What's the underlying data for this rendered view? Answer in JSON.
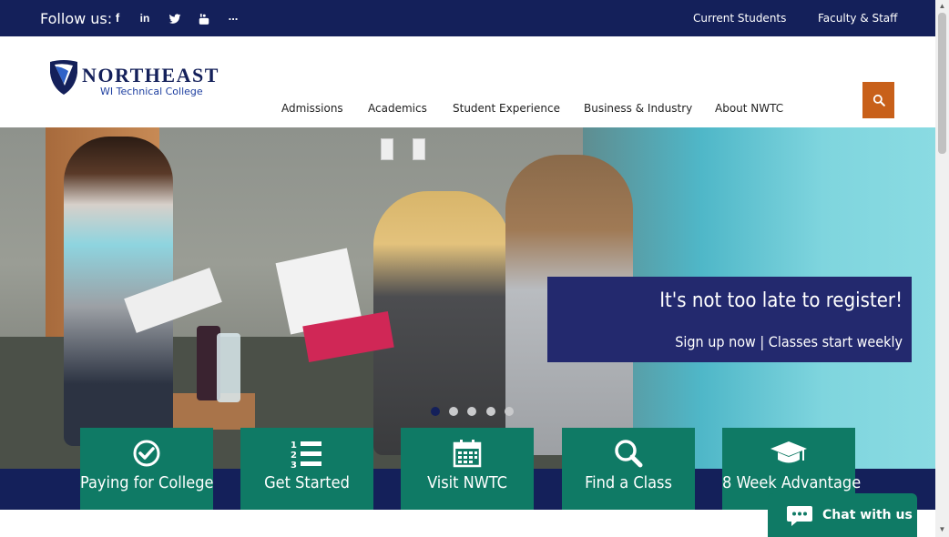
{
  "topbar": {
    "follow_label": "Follow us:",
    "social": [
      {
        "icon": "facebook-icon",
        "glyph": "f"
      },
      {
        "icon": "linkedin-icon",
        "glyph": "in"
      },
      {
        "icon": "twitter-icon",
        "glyph": ""
      },
      {
        "icon": "youtube-icon",
        "glyph": ""
      },
      {
        "icon": "more-icon",
        "glyph": "..."
      }
    ],
    "links": [
      "Current Students",
      "Faculty & Staff"
    ]
  },
  "header": {
    "logo_name": "NORTHEAST",
    "logo_sub": "WI Technical College",
    "nav": [
      "Admissions",
      "Academics",
      "Student Experience",
      "Business & Industry",
      "About NWTC"
    ]
  },
  "hero": {
    "promo_title": "It's not too late to register!",
    "promo_sub": "Sign up now | Classes start weekly",
    "slide_count": 5,
    "active_slide": 1
  },
  "tiles": [
    {
      "label": "Paying for College",
      "icon": "check-circle-icon"
    },
    {
      "label": "Get Started",
      "icon": "numbered-list-icon"
    },
    {
      "label": "Visit NWTC",
      "icon": "calendar-icon"
    },
    {
      "label": "Find a Class",
      "icon": "search-icon"
    },
    {
      "label": "8 Week Advantage",
      "icon": "graduation-cap-icon"
    }
  ],
  "chat": {
    "label": "Chat with us"
  },
  "colors": {
    "navy": "#14205a",
    "teal": "#0f7a65",
    "orange": "#c8601a",
    "promo": "#23296e"
  }
}
